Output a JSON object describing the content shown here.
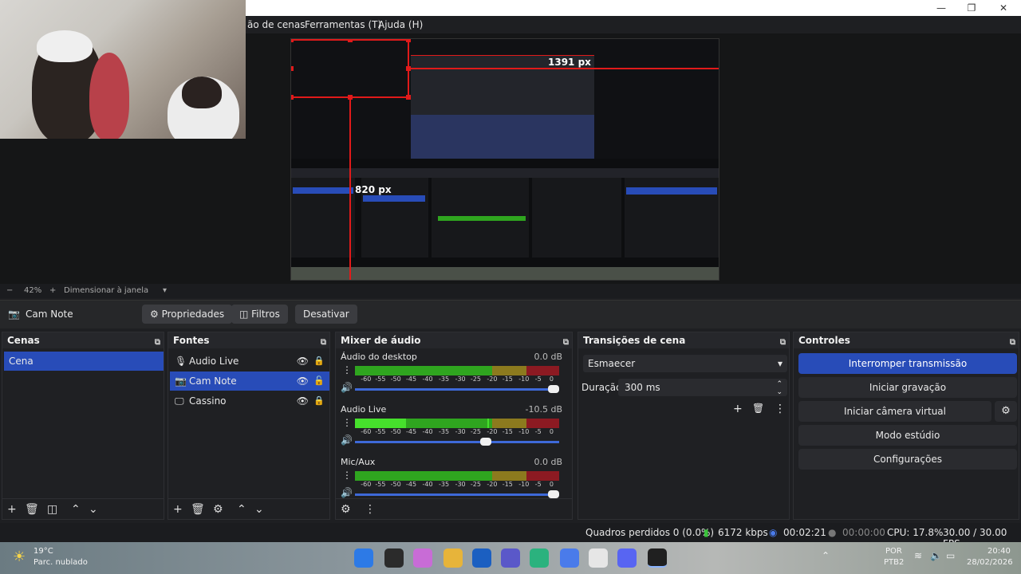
{
  "menu": {
    "items": [
      "ão de cenas",
      "Ferramentas (T)",
      "Ajuda (H)"
    ]
  },
  "window": {
    "minimize": "—",
    "restore": "❐",
    "close": "✕"
  },
  "preview": {
    "label_width": "1391 px",
    "label_height": "820 px"
  },
  "zoom": {
    "minus": "−",
    "value": "42%",
    "plus": "+",
    "mode": "Dimensionar à janela"
  },
  "source_toolbar": {
    "current_source": "Cam Note",
    "properties": "Propriedades",
    "filters": "Filtros",
    "deactivate": "Desativar"
  },
  "scenes": {
    "title": "Cenas",
    "items": [
      {
        "label": "Cena",
        "selected": true
      }
    ]
  },
  "sources": {
    "title": "Fontes",
    "items": [
      {
        "label": "Audio Live",
        "icon": "microphone-icon",
        "selected": false
      },
      {
        "label": "Cam Note",
        "icon": "camera-icon",
        "selected": true
      },
      {
        "label": "Cassino",
        "icon": "monitor-icon",
        "selected": false
      }
    ]
  },
  "mixer": {
    "title": "Mixer de áudio",
    "ticks": [
      "-60",
      "-55",
      "-50",
      "-45",
      "-40",
      "-35",
      "-30",
      "-25",
      "-20",
      "-15",
      "-10",
      "-5",
      "0"
    ],
    "channels": [
      {
        "name": "Áudio do desktop",
        "db": "0.0 dB",
        "level": 0.0,
        "volume": 1.0
      },
      {
        "name": "Audio Live",
        "db": "-10.5 dB",
        "level": 0.25,
        "volume": 0.65
      },
      {
        "name": "Mic/Aux",
        "db": "0.0 dB",
        "level": 0.0,
        "volume": 1.0
      }
    ]
  },
  "transitions": {
    "title": "Transições de cena",
    "selected": "Esmaecer",
    "duration_label": "Duração",
    "duration_value": "300 ms"
  },
  "controls": {
    "title": "Controles",
    "stop_stream": "Interromper transmissão",
    "start_recording": "Iniciar gravação",
    "virtual_camera": "Iniciar câmera virtual",
    "studio_mode": "Modo estúdio",
    "settings": "Configurações"
  },
  "status": {
    "dropped_frames": "Quadros perdidos 0 (0.0%)",
    "bitrate": "6172 kbps",
    "stream_time": "00:02:21",
    "record_time": "00:00:00",
    "cpu": "CPU: 17.8%",
    "fps": "30.00 / 30.00 FPS"
  },
  "taskbar": {
    "weather_temp": "19°C",
    "weather_desc": "Parc. nublado",
    "lang_1": "POR",
    "lang_2": "PTB2",
    "time": "20:40",
    "date": "28/02/2026"
  },
  "colors": {
    "accent": "#284cb8",
    "meter_green": "#2fa51f",
    "meter_bright_green": "#46e02c",
    "meter_yellow": "#8c7a1e",
    "meter_red": "#8c1a22",
    "selection_red": "#e11a1a"
  }
}
